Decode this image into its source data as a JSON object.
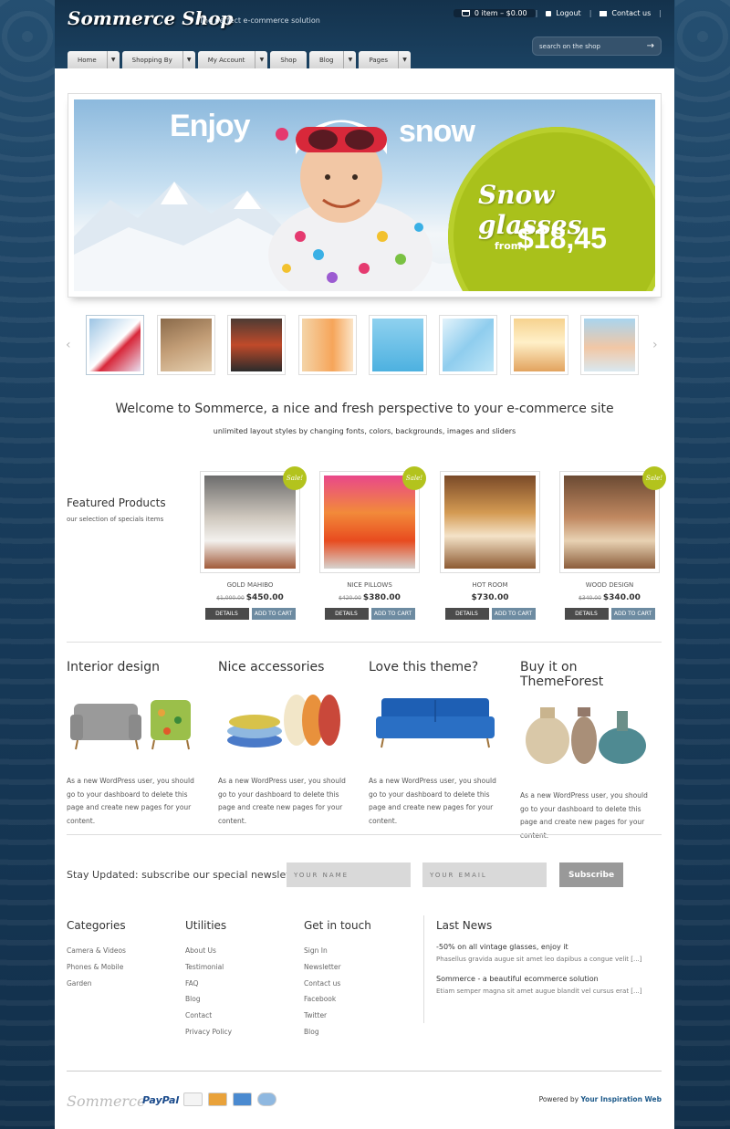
{
  "header": {
    "logo": "Sommerce Shop",
    "tagline": "The perfect e-commerce solution",
    "cart": "0 item – $0.00",
    "logout": "Logout",
    "contact": "Contact us",
    "search_placeholder": "search on the shop"
  },
  "nav": [
    {
      "label": "Home",
      "has_dropdown": true
    },
    {
      "label": "Shopping By",
      "has_dropdown": true
    },
    {
      "label": "My Account",
      "has_dropdown": true
    },
    {
      "label": "Shop",
      "has_dropdown": false
    },
    {
      "label": "Blog",
      "has_dropdown": true
    },
    {
      "label": "Pages",
      "has_dropdown": true
    }
  ],
  "slider": {
    "word1": "Enjoy",
    "word2": "snow",
    "promo_title": "Snow glasses",
    "promo_from": "from",
    "promo_price": "$18,45"
  },
  "welcome": {
    "title": "Welcome to Sommerce, a nice and fresh perspective to your e-commerce site",
    "subtitle": "unlimited layout styles by changing fonts, colors, backgrounds, images and sliders"
  },
  "featured": {
    "title": "Featured Products",
    "subtitle": "our selection of specials items",
    "sale_label": "Sale!",
    "details_label": "DETAILS",
    "cart_label": "ADD TO CART",
    "products": [
      {
        "name": "GOLD MAHIBO",
        "old_price": "$1,000.00",
        "price": "$450.00",
        "sale": true
      },
      {
        "name": "NICE PILLOWS",
        "old_price": "$420.00",
        "price": "$380.00",
        "sale": true
      },
      {
        "name": "HOT ROOM",
        "old_price": "",
        "price": "$730.00",
        "sale": false
      },
      {
        "name": "WOOD DESIGN",
        "old_price": "$340.00",
        "price": "$340.00",
        "sale": true
      }
    ]
  },
  "features": [
    {
      "title": "Interior design",
      "text": "As a new WordPress user, you should go to your dashboard to delete this page and create new pages for your content."
    },
    {
      "title": "Nice accessories",
      "text": "As a new WordPress user, you should go to your dashboard to delete this page and create new pages for your content."
    },
    {
      "title": "Love this theme?",
      "text": "As a new WordPress user, you should go to your dashboard to delete this page and create new pages for your content."
    },
    {
      "title": "Buy it on ThemeForest",
      "text": "As a new WordPress user, you should go to your dashboard to delete this page and create new pages for your content."
    }
  ],
  "newsletter": {
    "title": "Stay Updated: subscribe our special newsletter",
    "name_placeholder": "YOUR NAME",
    "email_placeholder": "YOUR EMAIL",
    "button": "Subscribe"
  },
  "footer": {
    "categories": {
      "title": "Categories",
      "items": [
        "Camera & Videos",
        "Phones & Mobile",
        "Garden"
      ]
    },
    "utilities": {
      "title": "Utilities",
      "items": [
        "About Us",
        "Testimonial",
        "FAQ",
        "Blog",
        "Contact",
        "Privacy Policy"
      ]
    },
    "contact": {
      "title": "Get in touch",
      "items": [
        "Sign In",
        "Newsletter",
        "Contact us",
        "Facebook",
        "Twitter",
        "Blog"
      ]
    },
    "news": {
      "title": "Last News",
      "items": [
        {
          "title": "-50% on all vintage glasses, enjoy it",
          "text": "Phasellus gravida augue sit amet leo dapibus a congue velit [...]"
        },
        {
          "title": "Sommerce - a beautiful ecommerce solution",
          "text": "Etiam semper magna sit amet augue blandit vel cursus erat [...]"
        }
      ]
    }
  },
  "bottom": {
    "logo": "Sommerce",
    "paypal": "PayPal",
    "cards": [
      "VISA",
      "MC",
      "AMEX",
      "Cirrus"
    ],
    "powered_prefix": "Powered by",
    "powered_link": "Your Inspiration Web"
  }
}
